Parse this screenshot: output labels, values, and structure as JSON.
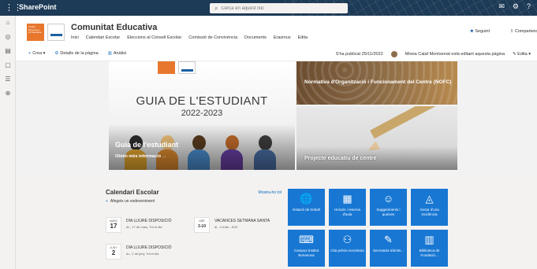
{
  "suitebar": {
    "app_name": "SharePoint",
    "search_placeholder": "Cerca en aquest lloc",
    "icons": [
      "waffle-icon",
      "chat-icon",
      "settings-icon",
      "help-icon"
    ]
  },
  "leftrail": {
    "icons": [
      "home-icon",
      "globe-icon",
      "news-icon",
      "files-icon",
      "lists-icon",
      "create-icon"
    ]
  },
  "site": {
    "title": "Comunitat Educativa",
    "nav": [
      "Inici",
      "Calendari Escolar",
      "Eleccions al Consell Escolar",
      "Comissió de Convivència",
      "Documents",
      "Erasmus",
      "Edita"
    ],
    "follow_label": "Seguint",
    "share_label": "Comparteix"
  },
  "cmdbar": {
    "new_label": "Crea",
    "details_label": "Detalls de la pàgina",
    "analytics_label": "Anàlisi",
    "published": "S'ha publicat 25/11/2022",
    "editor": "Mireia Calaf Montserrat està editant aquesta pàgina",
    "edit_label": "Edita"
  },
  "hero": {
    "main_line1": "GUIA DE L'ESTUDIANT",
    "main_line2": "2022-2023",
    "main_caption": "Guia de l'estudiant",
    "main_sub": "Obtén més informació  →",
    "tr_title": "Normativa d'Organització i Funcionament del Centre (NOFC)",
    "br_title": "Projecte educatiu de centre"
  },
  "calendar": {
    "title": "Calendari Escolar",
    "see_all": "Mostra-ho tot",
    "add_event": "Afegeix un esdeveniment",
    "events": [
      {
        "month": "MARÇ",
        "day": "17",
        "title": "DIA LLIURE DISPOSICIÓ",
        "sub": "dv., 17 de març, Tot el dia"
      },
      {
        "month": "ABR",
        "day": "3-10",
        "title": "VACANCES SETMANA SANTA",
        "sub": "dl., 3 d'abr., 8:00"
      },
      {
        "month": "JUNY",
        "day": "2",
        "title": "DIA LLIURE DISPOSICIÓ",
        "sub": "dv., 2 de juny, Tot el dia"
      }
    ]
  },
  "quicklinks": [
    {
      "label": "Estació de treball",
      "icon": "globe-icon",
      "glyph": "🌐"
    },
    {
      "label": "Horaris i reserva d'aula",
      "icon": "calendar-icon",
      "glyph": "▦"
    },
    {
      "label": "Suggeriments i queixes",
      "icon": "feedback-icon",
      "glyph": "☺"
    },
    {
      "label": "Avisar d'una incidència",
      "icon": "alert-icon",
      "glyph": "◬"
    },
    {
      "label": "Campus Institut Bonanova",
      "icon": "laptop-icon",
      "glyph": "⌨"
    },
    {
      "label": "Cita prèvia secretaria",
      "icon": "people-icon",
      "glyph": "⚇"
    },
    {
      "label": "Secretaria tràmits...",
      "icon": "form-icon",
      "glyph": "✎"
    },
    {
      "label": "Biblioteca de Fundació...",
      "icon": "library-icon",
      "glyph": "▥"
    }
  ]
}
